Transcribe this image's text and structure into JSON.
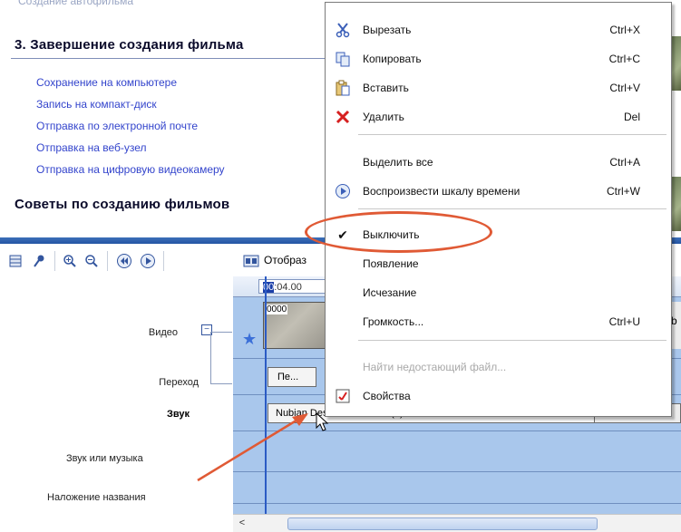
{
  "task_pane": {
    "faded_top_text": "Создание автофильма",
    "section3_title": "3. Завершение создания фильма",
    "links": [
      "Сохранение на компьютере",
      "Запись на компакт-диск",
      "Отправка по электронной почте",
      "Отправка на веб-узел",
      "Отправка на цифровую видеокамеру"
    ],
    "tips_title": "Советы по созданию фильмов"
  },
  "toolbar": {
    "buttons": [
      "storyboard-icon",
      "microphone-icon",
      "zoom-in-icon",
      "zoom-out-icon",
      "rewind-icon",
      "play-icon",
      "timeline-icon"
    ],
    "show_label": "Отобраз"
  },
  "timeline": {
    "time_prefix": "00",
    "time_value": ":04.00",
    "clip_number": "0000",
    "transition_clip_label": "Пе...",
    "audio_clip_label": "Nubian Desert Ruins.wav (1)",
    "right_clip_label": "b",
    "tracks": {
      "video": "Видео",
      "transition": "Переход",
      "audio": "Звук",
      "audio_music": "Звук или музыка",
      "title_overlay": "Наложение названия"
    },
    "scroll_left": "<"
  },
  "context_menu": {
    "items": [
      {
        "label": "Вырезать",
        "shortcut": "Ctrl+X",
        "icon": "scissors-icon"
      },
      {
        "label": "Копировать",
        "shortcut": "Ctrl+C",
        "icon": "copy-icon"
      },
      {
        "label": "Вставить",
        "shortcut": "Ctrl+V",
        "icon": "paste-icon"
      },
      {
        "label": "Удалить",
        "shortcut": "Del",
        "icon": "delete-icon"
      },
      {
        "label": "Выделить все",
        "shortcut": "Ctrl+A",
        "icon": ""
      },
      {
        "label": "Воспроизвести шкалу времени",
        "shortcut": "Ctrl+W",
        "icon": "play-circle-icon"
      },
      {
        "label": "Выключить",
        "shortcut": "",
        "icon": "checkmark-icon",
        "checked": true
      },
      {
        "label": "Появление",
        "shortcut": "",
        "icon": ""
      },
      {
        "label": "Исчезание",
        "shortcut": "",
        "icon": ""
      },
      {
        "label": "Громкость...",
        "shortcut": "Ctrl+U",
        "icon": ""
      },
      {
        "label": "Найти недостающий файл...",
        "shortcut": "",
        "icon": "",
        "disabled": true
      },
      {
        "label": "Свойства",
        "shortcut": "",
        "icon": "properties-icon"
      }
    ]
  },
  "colors": {
    "link": "#3344cc",
    "track_bg": "#a9c7ec",
    "annotation": "#e05a35",
    "delete_red": "#d62020"
  }
}
